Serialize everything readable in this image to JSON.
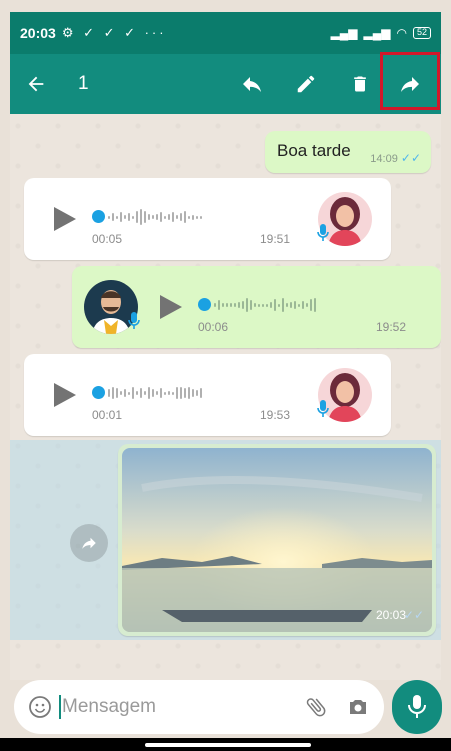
{
  "status_bar": {
    "time": "20:03",
    "left_icons": "⚙ ✓ ✓ ✓ ···",
    "battery": "52"
  },
  "toolbar": {
    "selected_count": "1",
    "icons": [
      "back-arrow-icon",
      "reply-icon",
      "edit-icon",
      "delete-icon",
      "forward-icon"
    ]
  },
  "messages": [
    {
      "type": "text",
      "direction": "out",
      "text": "Boa tarde",
      "time": "14:09"
    },
    {
      "type": "voice",
      "direction": "in",
      "duration": "00:05",
      "time": "19:51"
    },
    {
      "type": "voice",
      "direction": "out",
      "duration": "00:06",
      "time": "19:52"
    },
    {
      "type": "voice",
      "direction": "in",
      "duration": "00:01",
      "time": "19:53"
    },
    {
      "type": "image",
      "direction": "out",
      "time": "20:03",
      "selected": true
    }
  ],
  "input": {
    "placeholder": "Mensagem"
  },
  "colors": {
    "header": "#128c7e",
    "status": "#0b7c6c",
    "outgoing": "#dcf8c6",
    "incoming": "#ffffff",
    "highlight": "#d2182a"
  }
}
